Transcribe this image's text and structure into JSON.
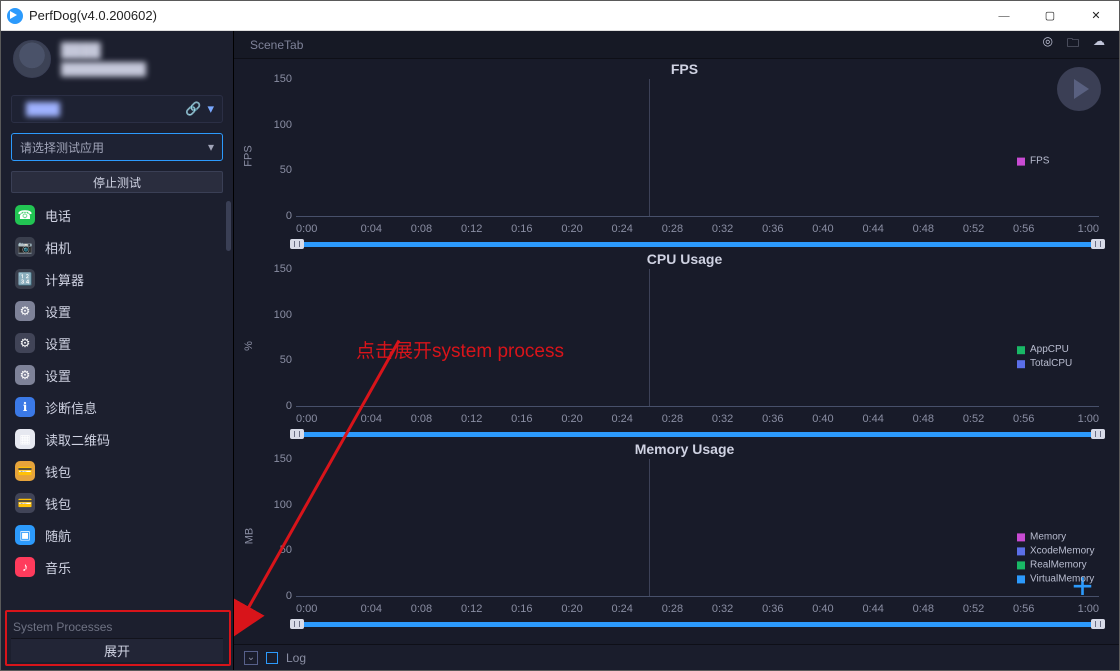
{
  "window": {
    "title": "PerfDog(v4.0.200602)"
  },
  "profile": {
    "line1": "████",
    "line2": "██████████"
  },
  "device": {
    "name": "████",
    "link_icon": "🔗"
  },
  "app_select": {
    "placeholder": "请选择测试应用"
  },
  "stop_button": {
    "label": "停止测试"
  },
  "apps": [
    {
      "name": "电话",
      "color": "#22c553",
      "glyph": "☎"
    },
    {
      "name": "相机",
      "color": "#3a3f4d",
      "glyph": "📷"
    },
    {
      "name": "计算器",
      "color": "#3a3f4d",
      "glyph": "🔢"
    },
    {
      "name": "设置",
      "color": "#7e8298",
      "glyph": "⚙"
    },
    {
      "name": "设置",
      "color": "#414457",
      "glyph": "⚙"
    },
    {
      "name": "设置",
      "color": "#7e8298",
      "glyph": "⚙"
    },
    {
      "name": "诊断信息",
      "color": "#3b79e6",
      "glyph": "ℹ"
    },
    {
      "name": "读取二维码",
      "color": "#e6e8f0",
      "glyph": "▦"
    },
    {
      "name": "钱包",
      "color": "#e6a33b",
      "glyph": "💳"
    },
    {
      "name": "钱包",
      "color": "#414457",
      "glyph": "💳"
    },
    {
      "name": "随航",
      "color": "#2c9afc",
      "glyph": "▣"
    },
    {
      "name": "音乐",
      "color": "#ff3b5c",
      "glyph": "♪"
    }
  ],
  "sys_section": {
    "label": "System Processes",
    "expand": "展开"
  },
  "scene": {
    "tab": "SceneTab"
  },
  "chart_data": [
    {
      "type": "line",
      "title": "FPS",
      "ylabel": "FPS",
      "ylim": [
        0,
        150
      ],
      "yticks": [
        0,
        50,
        100,
        150
      ],
      "x": [
        "0:00",
        "0:04",
        "0:08",
        "0:12",
        "0:16",
        "0:20",
        "0:24",
        "0:28",
        "0:32",
        "0:36",
        "0:40",
        "0:44",
        "0:48",
        "0:52",
        "0:56",
        "1:00"
      ],
      "series": [
        {
          "name": "FPS",
          "color": "#c84bd3",
          "values": []
        }
      ]
    },
    {
      "type": "line",
      "title": "CPU Usage",
      "ylabel": "%",
      "ylim": [
        0,
        150
      ],
      "yticks": [
        0,
        50,
        100,
        150
      ],
      "x": [
        "0:00",
        "0:04",
        "0:08",
        "0:12",
        "0:16",
        "0:20",
        "0:24",
        "0:28",
        "0:32",
        "0:36",
        "0:40",
        "0:44",
        "0:48",
        "0:52",
        "0:56",
        "1:00"
      ],
      "series": [
        {
          "name": "AppCPU",
          "color": "#19b866",
          "values": []
        },
        {
          "name": "TotalCPU",
          "color": "#5b6fe8",
          "values": []
        }
      ]
    },
    {
      "type": "line",
      "title": "Memory Usage",
      "ylabel": "MB",
      "ylim": [
        0,
        150
      ],
      "yticks": [
        0,
        50,
        100,
        150
      ],
      "x": [
        "0:00",
        "0:04",
        "0:08",
        "0:12",
        "0:16",
        "0:20",
        "0:24",
        "0:28",
        "0:32",
        "0:36",
        "0:40",
        "0:44",
        "0:48",
        "0:52",
        "0:56",
        "1:00"
      ],
      "series": [
        {
          "name": "Memory",
          "color": "#c84bd3",
          "values": []
        },
        {
          "name": "XcodeMemory",
          "color": "#5b6fe8",
          "values": []
        },
        {
          "name": "RealMemory",
          "color": "#19b866",
          "values": []
        },
        {
          "name": "VirtualMemory",
          "color": "#2c9afc",
          "values": []
        }
      ]
    }
  ],
  "log": {
    "label": "Log"
  },
  "annotation": {
    "text": "点击展开system process"
  }
}
